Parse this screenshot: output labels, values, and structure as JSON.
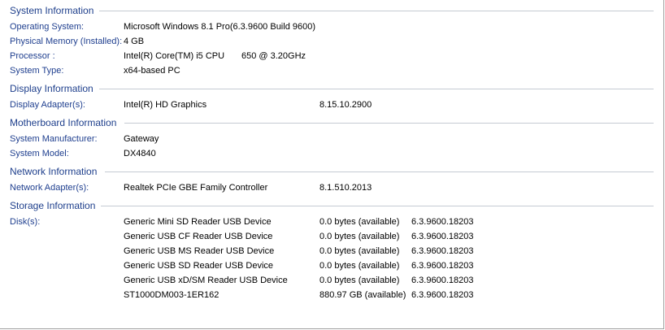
{
  "system": {
    "header": "System Information",
    "os_label": "Operating System:",
    "os_value": "Microsoft Windows 8.1 Pro(6.3.9600 Build 9600)",
    "memory_label": "Physical Memory (Installed):",
    "memory_value": "4 GB",
    "processor_label": "Processor  :",
    "processor_value": "Intel(R) Core(TM) i5 CPU",
    "processor_speed": "650  @ 3.20GHz",
    "type_label": "System Type:",
    "type_value": "x64-based PC"
  },
  "display": {
    "header": "Display Information",
    "adapter_label": "Display Adapter(s):",
    "adapter_name": "Intel(R) HD Graphics",
    "adapter_version": "8.15.10.2900"
  },
  "motherboard": {
    "header": "Motherboard Information",
    "manufacturer_label": "System Manufacturer:",
    "manufacturer_value": "Gateway",
    "model_label": "System Model:",
    "model_value": "DX4840"
  },
  "network": {
    "header": "Network Information",
    "adapter_label": "Network Adapter(s):",
    "adapter_name": "Realtek PCIe GBE Family Controller",
    "adapter_version": "8.1.510.2013"
  },
  "storage": {
    "header": "Storage Information",
    "disks_label": "Disk(s):",
    "disks": [
      {
        "name": "Generic Mini SD Reader USB Device",
        "available": "0.0 bytes (available)",
        "version": "6.3.9600.18203"
      },
      {
        "name": "Generic USB CF Reader USB Device",
        "available": "0.0 bytes (available)",
        "version": "6.3.9600.18203"
      },
      {
        "name": "Generic USB MS Reader USB Device",
        "available": "0.0 bytes (available)",
        "version": "6.3.9600.18203"
      },
      {
        "name": "Generic USB SD Reader USB Device",
        "available": "0.0 bytes (available)",
        "version": "6.3.9600.18203"
      },
      {
        "name": "Generic USB xD/SM Reader USB Device",
        "available": "0.0 bytes (available)",
        "version": "6.3.9600.18203"
      },
      {
        "name": "ST1000DM003-1ER162",
        "available": "880.97 GB (available)",
        "version": "6.3.9600.18203"
      }
    ]
  },
  "colors": {
    "header_text": "#1e3f8c",
    "label_text": "#1f3f8f",
    "separator": "#c5cbd3"
  }
}
